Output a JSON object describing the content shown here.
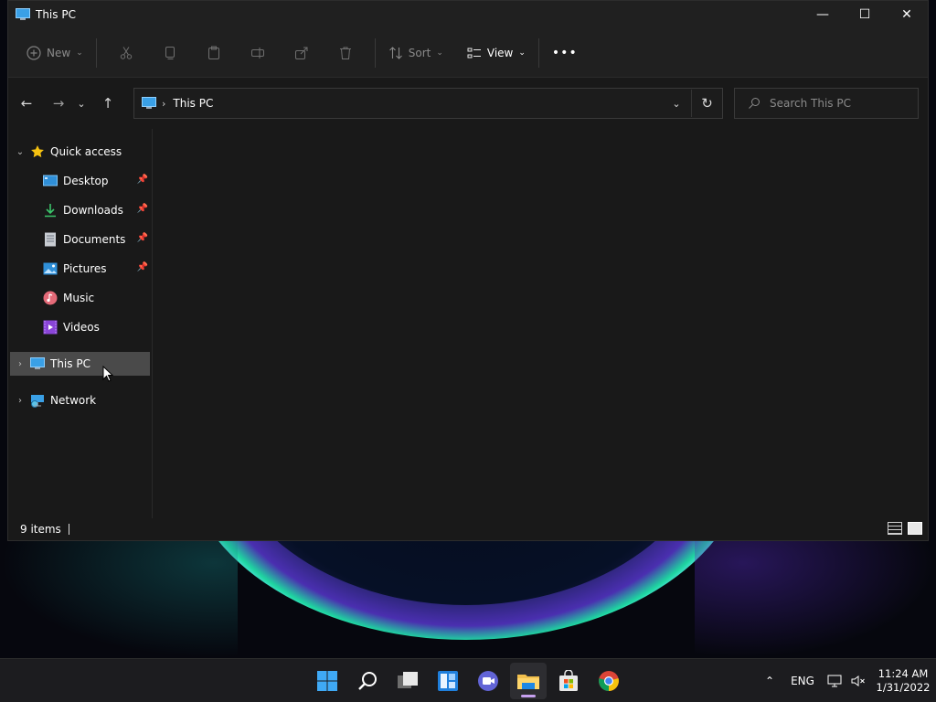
{
  "window": {
    "title": "This PC",
    "controls": {
      "minimize": "—",
      "maximize": "☐",
      "close": "✕"
    }
  },
  "commandbar": {
    "new_label": "New",
    "sort_label": "Sort",
    "view_label": "View",
    "more_label": "•••"
  },
  "address": {
    "location": "This PC",
    "separator": "›",
    "search_placeholder": "Search This PC"
  },
  "sidebar": {
    "quick_access": "Quick access",
    "pinned": [
      {
        "label": "Desktop",
        "icon": "desktop-icon",
        "pinned": true
      },
      {
        "label": "Downloads",
        "icon": "downloads-icon",
        "pinned": true
      },
      {
        "label": "Documents",
        "icon": "documents-icon",
        "pinned": true
      },
      {
        "label": "Pictures",
        "icon": "pictures-icon",
        "pinned": true
      },
      {
        "label": "Music",
        "icon": "music-icon",
        "pinned": false
      },
      {
        "label": "Videos",
        "icon": "videos-icon",
        "pinned": false
      }
    ],
    "this_pc": "This PC",
    "network": "Network"
  },
  "status": {
    "item_count": "9 items"
  },
  "tray": {
    "language": "ENG",
    "time": "11:24 AM",
    "date": "1/31/2022"
  },
  "taskbar_apps": [
    "start",
    "search",
    "task-view",
    "widgets",
    "chat",
    "file-explorer",
    "store",
    "chrome"
  ],
  "colors": {
    "window_bg": "#191919",
    "selection": "#4a4a4a",
    "accent": "#0078d4"
  }
}
